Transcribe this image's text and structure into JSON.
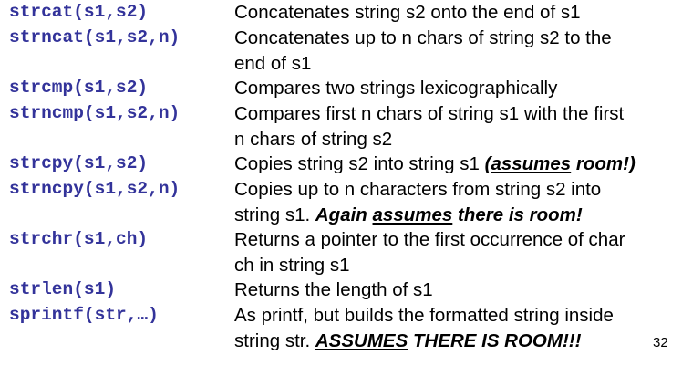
{
  "functions": [
    {
      "name": "strcat(s1,s2)",
      "lines": [
        [
          "Concatenates string s2 onto the end of s1"
        ]
      ]
    },
    {
      "name": "strncat(s1,s2,n)",
      "lines": [
        [
          "Concatenates up to n chars of string s2 to the"
        ],
        [
          "end of s1"
        ]
      ]
    },
    {
      "name": "strcmp(s1,s2)",
      "lines": [
        [
          "Compares two strings lexicographically"
        ]
      ]
    },
    {
      "name": "strncmp(s1,s2,n)",
      "lines": [
        [
          "Compares first n chars of string s1 with the first"
        ],
        [
          "n chars of string s2"
        ]
      ]
    },
    {
      "name": "strcpy(s1,s2)",
      "line1_prefix": "Copies string s2 into string s1 ",
      "line1_emph_open": "(",
      "line1_emph_u": "assumes",
      "line1_emph_close": " room!)"
    },
    {
      "name": "strncpy(s1,s2,n)",
      "line1": "Copies up to n characters from string s2 into",
      "line2_prefix": "string s1. ",
      "line2_emph_a": "Again ",
      "line2_emph_u": "assumes",
      "line2_emph_b": " there is room!"
    },
    {
      "name": "strchr(s1,ch)",
      "lines": [
        [
          "Returns a pointer to the first occurrence of char"
        ],
        [
          "ch in string s1"
        ]
      ]
    },
    {
      "name": "strlen(s1)",
      "lines": [
        [
          "Returns the length of s1"
        ]
      ]
    },
    {
      "name": "sprintf(str,…)",
      "line1": "As printf, but builds the formatted string inside",
      "line2_prefix": "string str. ",
      "line2_emph_u": "ASSUMES",
      "line2_emph_b": " THERE IS ROOM!!!"
    }
  ],
  "page_number": "32",
  "colors": {
    "function_name": "#33339a",
    "text": "#000000",
    "background": "#ffffff"
  }
}
